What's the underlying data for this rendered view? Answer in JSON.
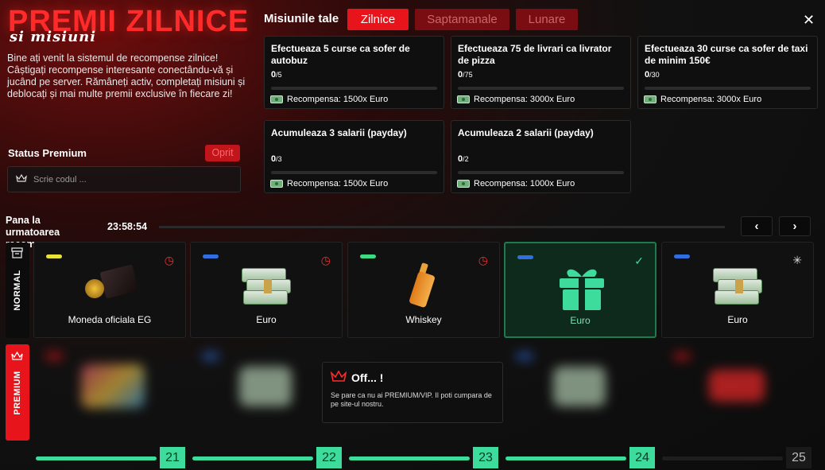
{
  "header": {
    "title_big": "PREMII ZILNICE",
    "title_small": "si misiuni",
    "intro": "Bine ați venit la sistemul de recompense zilnice! Câștigați recompense interesante conectându-vă și jucând pe server. Rămâneți activ, completați misiuni și deblocați și mai multe premii exclusive în fiecare zi!"
  },
  "premium": {
    "label": "Status Premium",
    "status": "Oprit",
    "placeholder": "Scrie codul ..."
  },
  "missions": {
    "label": "Misiunile tale",
    "tabs": [
      "Zilnice",
      "Saptamanale",
      "Lunare"
    ],
    "active_tab": "Zilnice",
    "items": [
      {
        "title": "Efectueaza 5 curse ca sofer de autobuz",
        "done": "0",
        "total": "/5",
        "reward": "Recompensa: 1500x Euro"
      },
      {
        "title": "Efectueaza 75 de livrari ca livrator de pizza",
        "done": "0",
        "total": "/75",
        "reward": "Recompensa: 3000x Euro"
      },
      {
        "title": "Efectueaza 30 curse ca sofer de taxi de minim 150€",
        "done": "0",
        "total": "/30",
        "reward": "Recompensa: 3000x Euro"
      },
      {
        "title": "Acumuleaza 3 salarii (payday)",
        "done": "0",
        "total": "/3",
        "reward": "Recompensa: 1500x Euro"
      },
      {
        "title": "Acumuleaza 2 salarii (payday)",
        "done": "0",
        "total": "/2",
        "reward": "Recompensa: 1000x Euro"
      }
    ]
  },
  "timer": {
    "label": "Pana la urmatoarea recompensa:",
    "value": "23:58:54"
  },
  "rows": {
    "normal_label": "NORMAL",
    "premium_label": "PREMIUM"
  },
  "rewards": [
    {
      "name": "Moneda oficiala EG",
      "pill_color": "#e8e23a",
      "status": "clock-icon",
      "icon": "coin-icon"
    },
    {
      "name": "Euro",
      "pill_color": "#2f6fe0",
      "status": "clock-icon",
      "icon": "money-stack-icon"
    },
    {
      "name": "Whiskey",
      "pill_color": "#3ddc84",
      "status": "clock-icon",
      "icon": "whiskey-bottle-icon"
    },
    {
      "name": "Euro",
      "pill_color": "#2f6fe0",
      "status": "check-icon",
      "icon": "gift-icon"
    },
    {
      "name": "Euro",
      "pill_color": "#2f6fe0",
      "status": "spinner-icon",
      "icon": "money-stack-icon"
    }
  ],
  "popup": {
    "title": "Off... !",
    "text": "Se pare ca nu ai PREMIUM/VIP. Il poti cumpara de pe site-ul nostru."
  },
  "levels": [
    "21",
    "22",
    "23",
    "24",
    "25"
  ],
  "colors": {
    "accent_red": "#e8141b",
    "accent_green": "#3ddc9c"
  }
}
